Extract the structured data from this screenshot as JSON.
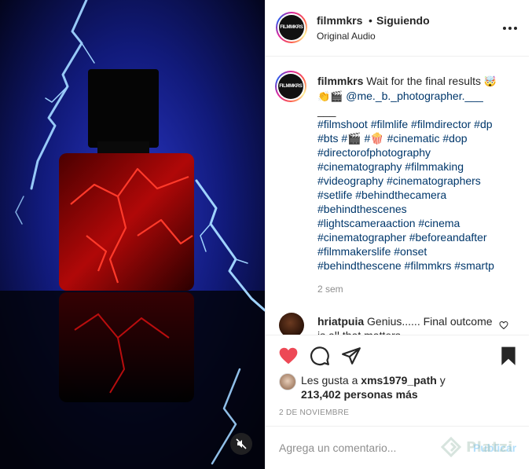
{
  "post": {
    "username": "filmmkrs",
    "separator": "•",
    "follow_status": "Siguiendo",
    "audio_label": "Original Audio",
    "avatar_text": "FILMMKRS"
  },
  "caption": {
    "username": "filmmkrs",
    "text": "Wait for the final results",
    "emoji_1": "🤯",
    "emoji_2": "👏🎬",
    "mention": "@me._b._photographer.___",
    "mention_tail": "___",
    "hashtag_lines": [
      "#filmshoot #filmlife #filmdirector #dp",
      "#bts #🎬 #🍿 #cinematic #dop",
      "#directorofphotography",
      "#cinematography #filmmaking",
      "#videography #cinematographers",
      "#setlife #behindthecamera",
      "#behindthescenes",
      "#lightscameraaction #cinema",
      "#cinematographer #beforeandafter",
      "#filmmakerslife #onset",
      "#behindthescene #filmmkrs #smartp"
    ],
    "time": "2 sem"
  },
  "comment": {
    "username": "hriatpuia",
    "text": "Genius...... Final outcome is all that matters"
  },
  "likes": {
    "prefix": "Les gusta a",
    "user": "xms1979_path",
    "conjunction": "y",
    "count": "213,402 personas más"
  },
  "date": "2 DE NOVIEMBRE",
  "composer": {
    "placeholder": "Agrega un comentario...",
    "publish_label": "Publicar"
  },
  "watermark": "Platzi",
  "colors": {
    "like_red": "#ed4956",
    "link_blue": "#00376b",
    "publish_disabled": "#b2dffc",
    "muted_gray": "#8e8e8e"
  },
  "icons": {
    "like": "heart-icon",
    "comment": "comment-bubble-icon",
    "share": "paper-plane-icon",
    "save": "bookmark-icon",
    "mute": "muted-speaker-icon",
    "more": "more-dots-icon"
  }
}
